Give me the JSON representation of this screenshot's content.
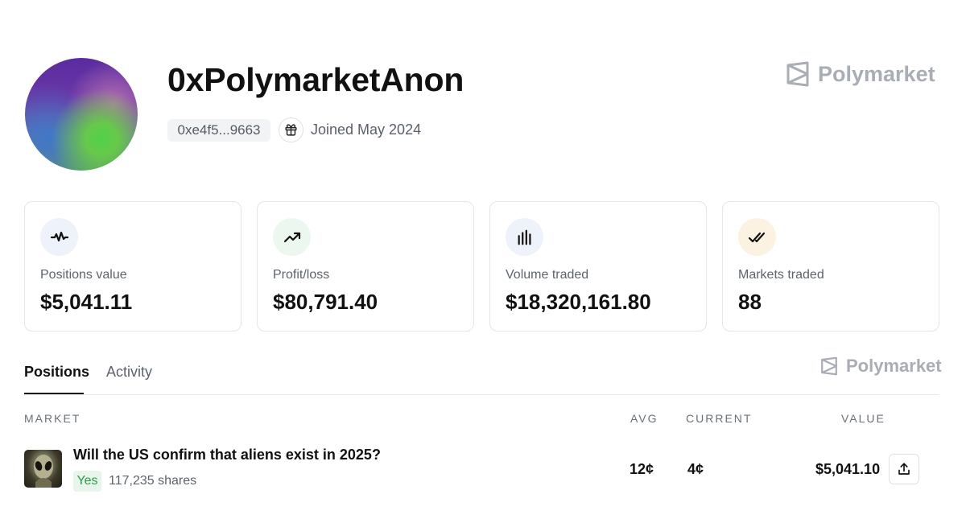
{
  "profile": {
    "username": "0xPolymarketAnon",
    "address": "0xe4f5...9663",
    "joined": "Joined May 2024"
  },
  "brand": {
    "name": "Polymarket",
    "color": "#a9adb4"
  },
  "stats": [
    {
      "label": "Positions value",
      "value": "$5,041.11",
      "icon": "activity-pulse-icon",
      "icon_bg": "#eef2fb"
    },
    {
      "label": "Profit/loss",
      "value": "$80,791.40",
      "icon": "trending-up-icon",
      "icon_bg": "#ecf7ef"
    },
    {
      "label": "Volume traded",
      "value": "$18,320,161.80",
      "icon": "bar-chart-icon",
      "icon_bg": "#eef2fb"
    },
    {
      "label": "Markets traded",
      "value": "88",
      "icon": "double-check-icon",
      "icon_bg": "#fbf2e2"
    }
  ],
  "tabs": [
    {
      "label": "Positions",
      "active": true
    },
    {
      "label": "Activity",
      "active": false
    }
  ],
  "table": {
    "headers": {
      "market": "MARKET",
      "avg": "AVG",
      "current": "CURRENT",
      "value": "VALUE"
    },
    "rows": [
      {
        "title": "Will the US confirm that aliens exist in 2025?",
        "outcome": "Yes",
        "shares": "117,235 shares",
        "avg": "12¢",
        "current": "4¢",
        "value": "$5,041.10"
      }
    ]
  },
  "colors": {
    "yes_text": "#2f9a45",
    "yes_bg": "#e8f5ea",
    "border": "#e3e6ea"
  }
}
